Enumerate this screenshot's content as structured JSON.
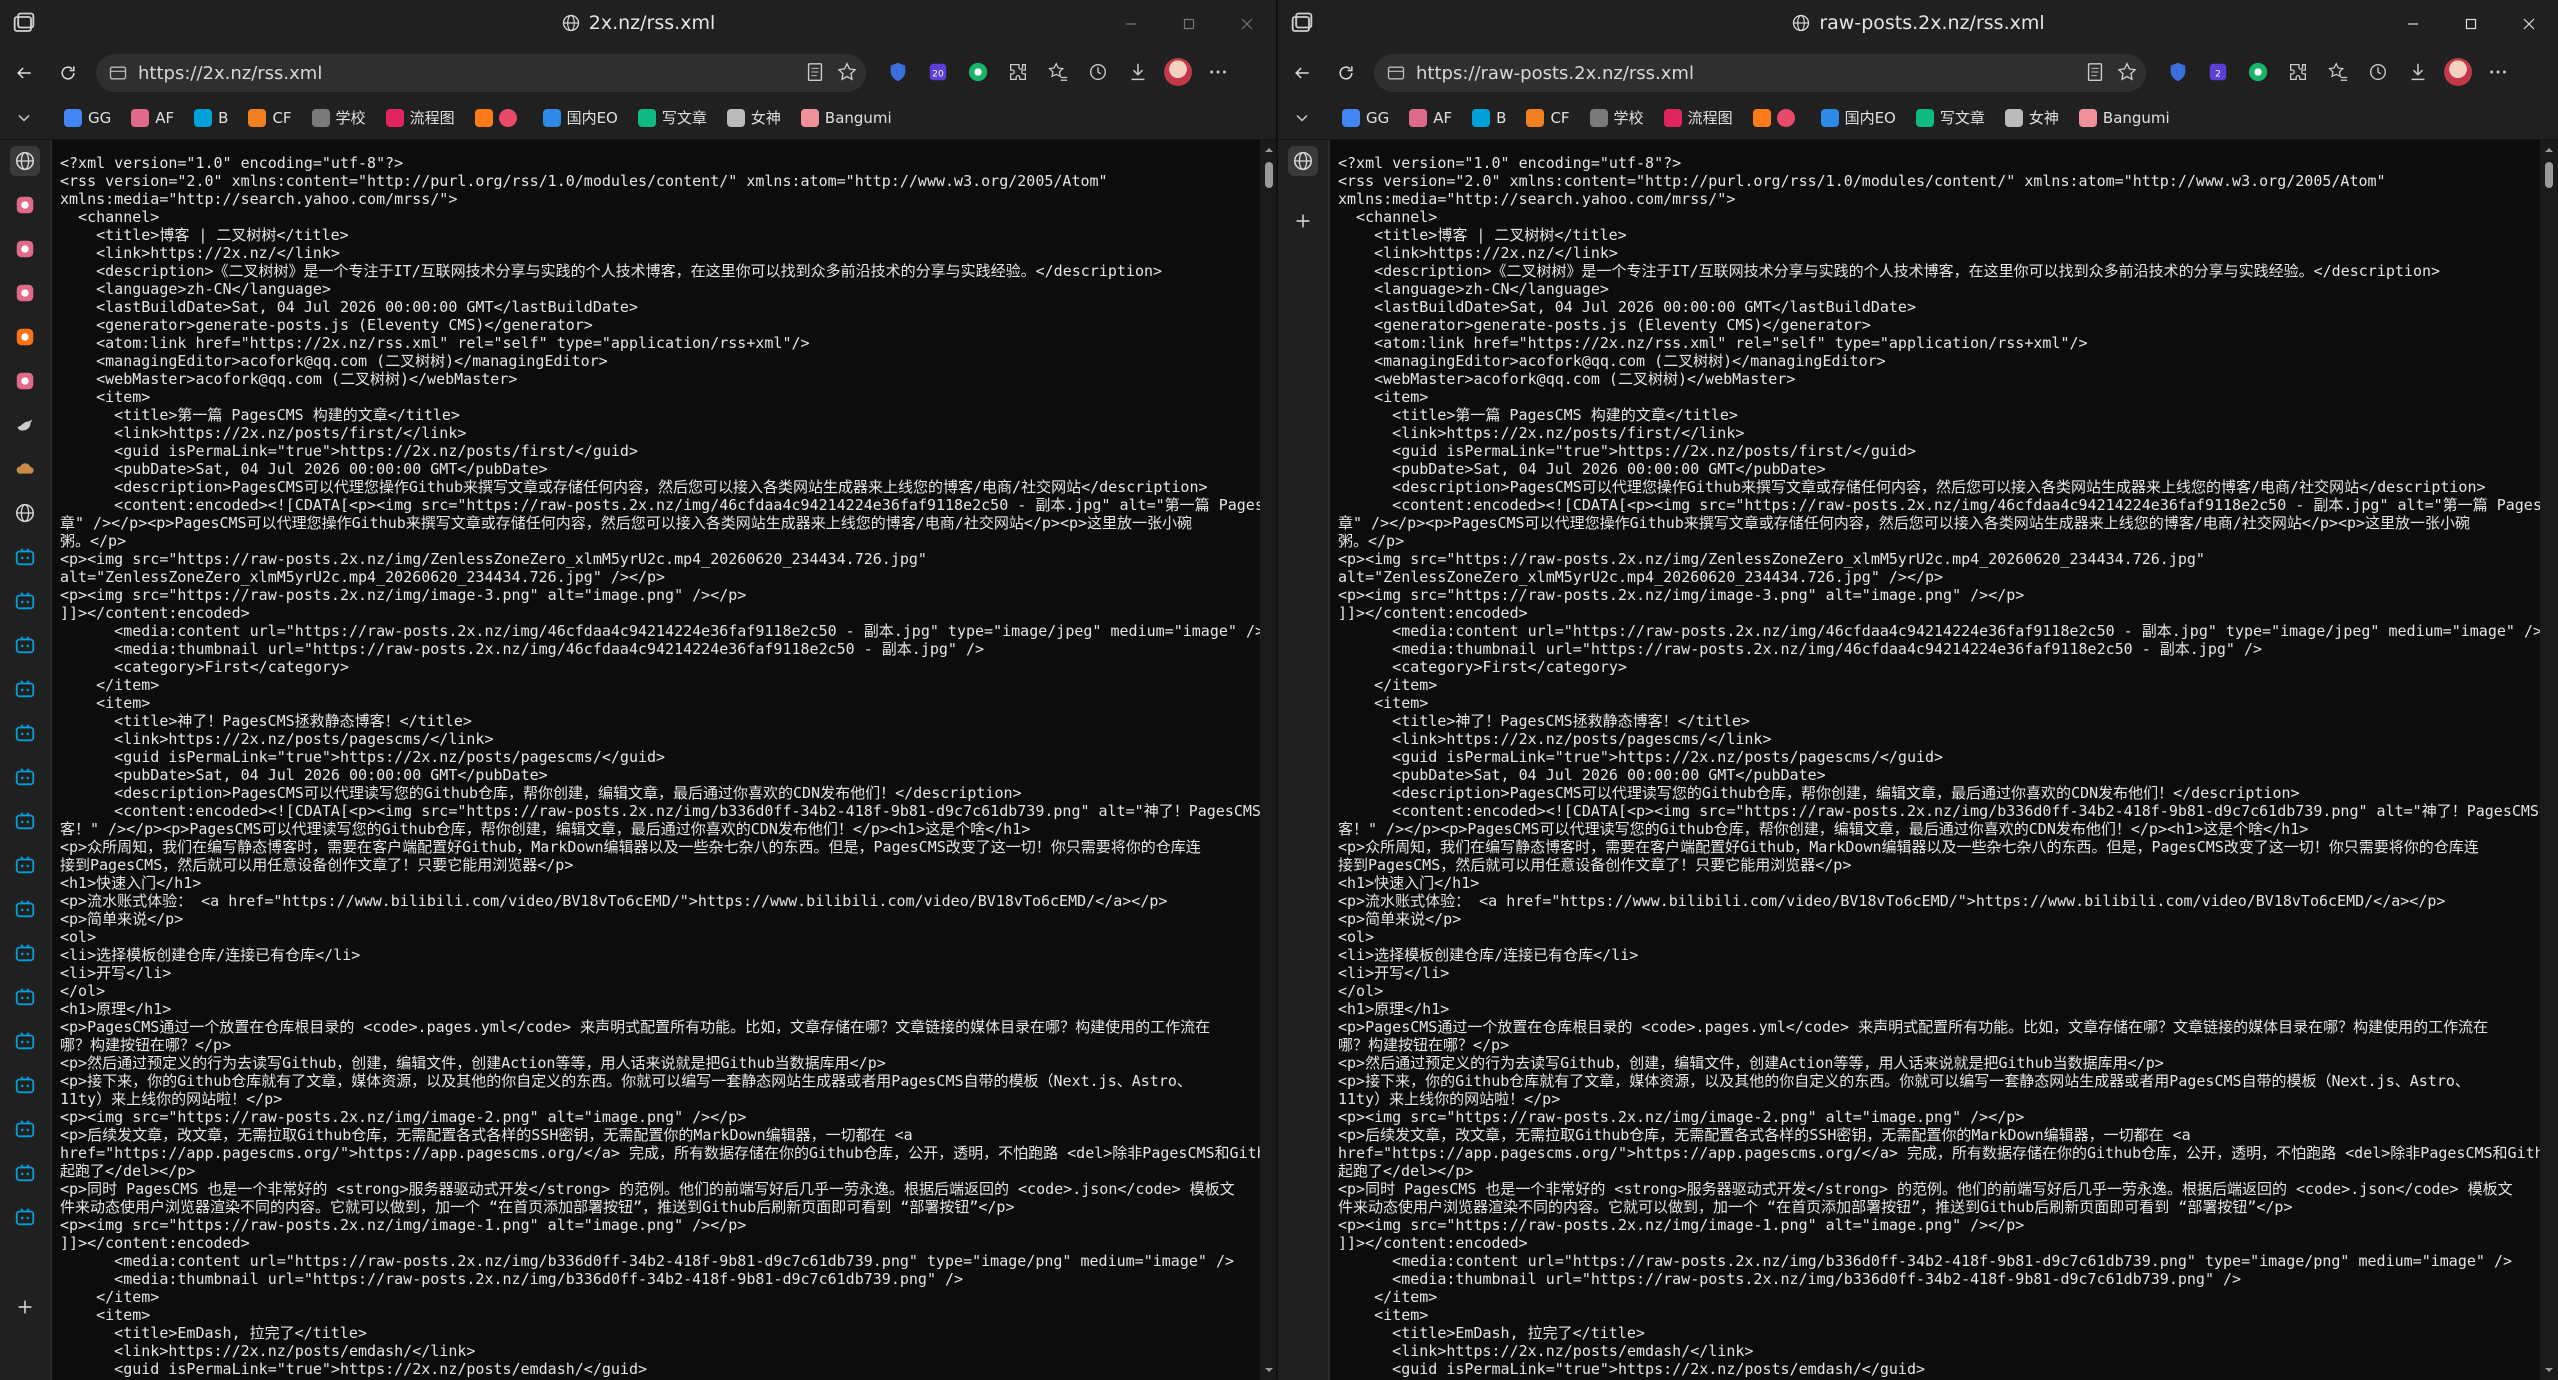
{
  "windows": [
    {
      "title": "2x.nz/rss.xml",
      "url": "https://2x.nz/rss.xml",
      "vertical_tabs": [
        "globe-icon",
        "site-icon",
        "site-icon",
        "site-icon",
        "site-icon",
        "site-icon",
        "bird-icon",
        "cloud-icon",
        "globe-icon",
        "bilibili-icon",
        "bilibili-icon",
        "bilibili-icon",
        "bilibili-icon",
        "bilibili-icon",
        "bilibili-icon",
        "bilibili-icon",
        "bilibili-icon",
        "bilibili-icon",
        "bilibili-icon",
        "bilibili-icon",
        "bilibili-icon",
        "bilibili-icon",
        "bilibili-icon",
        "bilibili-icon",
        "bilibili-icon"
      ]
    },
    {
      "title": "raw-posts.2x.nz/rss.xml",
      "url": "https://raw-posts.2x.nz/rss.xml",
      "vertical_tabs": [
        "globe-icon"
      ]
    }
  ],
  "bookmarks": [
    {
      "label": "GG",
      "color": "#4285f4"
    },
    {
      "label": "AF",
      "color": "#e06a8a"
    },
    {
      "label": "B",
      "color": "#00a1d6"
    },
    {
      "label": "CF",
      "color": "#f38020"
    },
    {
      "label": "学校",
      "color": "#7a7a7a"
    },
    {
      "label": "流程图",
      "color": "#e0245e"
    },
    {
      "label": "",
      "color": "#ff7a18"
    },
    {
      "label": "国内EO",
      "color": "#2e8ae6"
    },
    {
      "label": "写文章",
      "color": "#10b981"
    },
    {
      "label": "女神",
      "color": "#bbbbbb"
    },
    {
      "label": "Bangumi",
      "color": "#f09199"
    }
  ],
  "colors": {
    "accent": "#4aa3ff",
    "content_bg": "#0c0c0c",
    "chrome_bg": "#202020"
  },
  "source_lines": [
    "<?xml version=\"1.0\" encoding=\"utf-8\"?>",
    "<rss version=\"2.0\" xmlns:content=\"http://purl.org/rss/1.0/modules/content/\" xmlns:atom=\"http://www.w3.org/2005/Atom\"",
    "xmlns:media=\"http://search.yahoo.com/mrss/\">",
    "  <channel>",
    "    <title>博客 | 二叉树树</title>",
    "    <link>https://2x.nz/</link>",
    "    <description>《二叉树树》是一个专注于IT/互联网技术分享与实践的个人技术博客，在这里你可以找到众多前沿技术的分享与实践经验。</description>",
    "    <language>zh-CN</language>",
    "    <lastBuildDate>Sat, 04 Jul 2026 00:00:00 GMT</lastBuildDate>",
    "    <generator>generate-posts.js (Eleventy CMS)</generator>",
    "    <atom:link href=\"https://2x.nz/rss.xml\" rel=\"self\" type=\"application/rss+xml\"/>",
    "    <managingEditor>acofork@qq.com (二叉树树)</managingEditor>",
    "    <webMaster>acofork@qq.com (二叉树树)</webMaster>",
    "    <item>",
    "      <title>第一篇 PagesCMS 构建的文章</title>",
    "      <link>https://2x.nz/posts/first/</link>",
    "      <guid isPermaLink=\"true\">https://2x.nz/posts/first/</guid>",
    "      <pubDate>Sat, 04 Jul 2026 00:00:00 GMT</pubDate>",
    "      <description>PagesCMS可以代理您操作Github来撰写文章或存储任何内容，然后您可以接入各类网站生成器来上线您的博客/电商/社交网站</description>",
    "      <content:encoded><![CDATA[<p><img src=\"https://raw-posts.2x.nz/img/46cfdaa4c94214224e36faf9118e2c50 - 副本.jpg\" alt=\"第一篇 PagesCMS 构建的文",
    "章\" /></p><p>PagesCMS可以代理您操作Github来撰写文章或存储任何内容，然后您可以接入各类网站生成器来上线您的博客/电商/社交网站</p><p>这里放一张小碗",
    "粥。</p>",
    "<p><img src=\"https://raw-posts.2x.nz/img/ZenlessZoneZero_xlmM5yrU2c.mp4_20260620_234434.726.jpg\"",
    "alt=\"ZenlessZoneZero_xlmM5yrU2c.mp4_20260620_234434.726.jpg\" /></p>",
    "<p><img src=\"https://raw-posts.2x.nz/img/image-3.png\" alt=\"image.png\" /></p>",
    "]]></content:encoded>",
    "      <media:content url=\"https://raw-posts.2x.nz/img/46cfdaa4c94214224e36faf9118e2c50 - 副本.jpg\" type=\"image/jpeg\" medium=\"image\" />",
    "      <media:thumbnail url=\"https://raw-posts.2x.nz/img/46cfdaa4c94214224e36faf9118e2c50 - 副本.jpg\" />",
    "      <category>First</category>",
    "    </item>",
    "    <item>",
    "      <title>神了！PagesCMS拯救静态博客！</title>",
    "      <link>https://2x.nz/posts/pagescms/</link>",
    "      <guid isPermaLink=\"true\">https://2x.nz/posts/pagescms/</guid>",
    "      <pubDate>Sat, 04 Jul 2026 00:00:00 GMT</pubDate>",
    "      <description>PagesCMS可以代理读写您的Github仓库，帮你创建，编辑文章，最后通过你喜欢的CDN发布他们！</description>",
    "      <content:encoded><![CDATA[<p><img src=\"https://raw-posts.2x.nz/img/b336d0ff-34b2-418f-9b81-d9c7c61db739.png\" alt=\"神了！PagesCMS拯救静态博",
    "客！\" /></p><p>PagesCMS可以代理读写您的Github仓库，帮你创建，编辑文章，最后通过你喜欢的CDN发布他们！</p><h1>这是个啥</h1>",
    "<p>众所周知，我们在编写静态博客时，需要在客户端配置好Github，MarkDown编辑器以及一些杂七杂八的东西。但是，PagesCMS改变了这一切！你只需要将你的仓库连",
    "接到PagesCMS，然后就可以用任意设备创作文章了！只要它能用浏览器</p>",
    "<h1>快速入门</h1>",
    "<p>流水账式体验： <a href=\"https://www.bilibili.com/video/BV18vTo6cEMD/\">https://www.bilibili.com/video/BV18vTo6cEMD/</a></p>",
    "<p>简单来说</p>",
    "<ol>",
    "<li>选择模板创建仓库/连接已有仓库</li>",
    "<li>开写</li>",
    "</ol>",
    "<h1>原理</h1>",
    "<p>PagesCMS通过一个放置在仓库根目录的 <code>.pages.yml</code> 来声明式配置所有功能。比如，文章存储在哪？文章链接的媒体目录在哪？构建使用的工作流在",
    "哪？构建按钮在哪？</p>",
    "<p>然后通过预定义的行为去读写Github，创建，编辑文件，创建Action等等，用人话来说就是把Github当数据库用</p>",
    "<p>接下来，你的Github仓库就有了文章，媒体资源，以及其他的你自定义的东西。你就可以编写一套静态网站生成器或者用PagesCMS自带的模板（Next.js、Astro、",
    "11ty）来上线你的网站啦！</p>",
    "<p><img src=\"https://raw-posts.2x.nz/img/image-2.png\" alt=\"image.png\" /></p>",
    "<p>后续发文章，改文章，无需拉取Github仓库，无需配置各式各样的SSH密钥，无需配置你的MarkDown编辑器，一切都在 <a",
    "href=\"https://app.pagescms.org/\">https://app.pagescms.org/</a> 完成，所有数据存储在你的Github仓库，公开，透明，不怕跑路 <del>除非PagesCMS和Github一",
    "起跑了</del></p>",
    "<p>同时 PagesCMS 也是一个非常好的 <strong>服务器驱动式开发</strong> 的范例。他们的前端写好后几乎一劳永逸。根据后端返回的 <code>.json</code> 模板文",
    "件来动态使用户浏览器渲染不同的内容。它就可以做到，加一个 “在首页添加部署按钮”，推送到Github后刷新页面即可看到 “部署按钮”</p>",
    "<p><img src=\"https://raw-posts.2x.nz/img/image-1.png\" alt=\"image.png\" /></p>",
    "]]></content:encoded>",
    "      <media:content url=\"https://raw-posts.2x.nz/img/b336d0ff-34b2-418f-9b81-d9c7c61db739.png\" type=\"image/png\" medium=\"image\" />",
    "      <media:thumbnail url=\"https://raw-posts.2x.nz/img/b336d0ff-34b2-418f-9b81-d9c7c61db739.png\" />",
    "    </item>",
    "    <item>",
    "      <title>EmDash, 拉完了</title>",
    "      <link>https://2x.nz/posts/emdash/</link>",
    "      <guid isPermaLink=\"true\">https://2x.nz/posts/emdash/</guid>"
  ]
}
